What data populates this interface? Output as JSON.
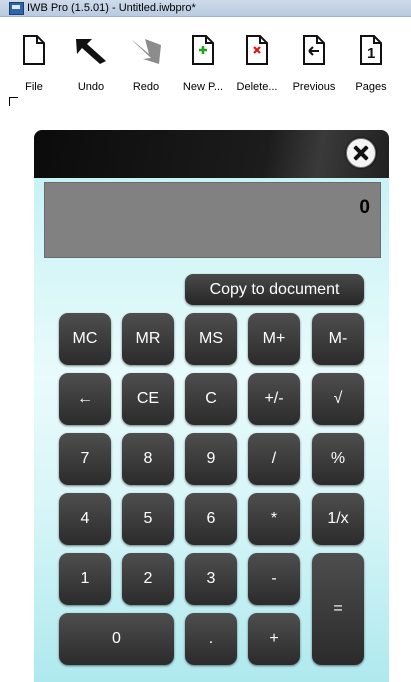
{
  "window": {
    "title": "IWB Pro (1.5.01) - Untitled.iwbpro*"
  },
  "toolbar": {
    "items": [
      {
        "label": "File",
        "icon": "file-icon"
      },
      {
        "label": "Undo",
        "icon": "undo-arrow-icon"
      },
      {
        "label": "Redo",
        "icon": "redo-arrow-icon"
      },
      {
        "label": "New P...",
        "icon": "new-page-icon"
      },
      {
        "label": "Delete...",
        "icon": "delete-page-icon"
      },
      {
        "label": "Previous",
        "icon": "previous-page-icon"
      },
      {
        "label": "Pages",
        "icon": "pages-icon",
        "badge": "1"
      }
    ]
  },
  "calculator": {
    "display": "0",
    "copy_label": "Copy to document",
    "keys": {
      "mc": "MC",
      "mr": "MR",
      "ms": "MS",
      "mplus": "M+",
      "mminus": "M-",
      "back": "←",
      "ce": "CE",
      "c": "C",
      "sign": "+/-",
      "sqrt": "√",
      "k7": "7",
      "k8": "8",
      "k9": "9",
      "div": "/",
      "pct": "%",
      "k4": "4",
      "k5": "5",
      "k6": "6",
      "mul": "*",
      "recip": "1/x",
      "k1": "1",
      "k2": "2",
      "k3": "3",
      "minus": "-",
      "eq": "=",
      "k0": "0",
      "dot": ".",
      "plus": "+"
    }
  },
  "colors": {
    "header": "#111111",
    "body_gradient": "#bff0f3",
    "display": "#818181",
    "key": "#3a3a3a"
  }
}
